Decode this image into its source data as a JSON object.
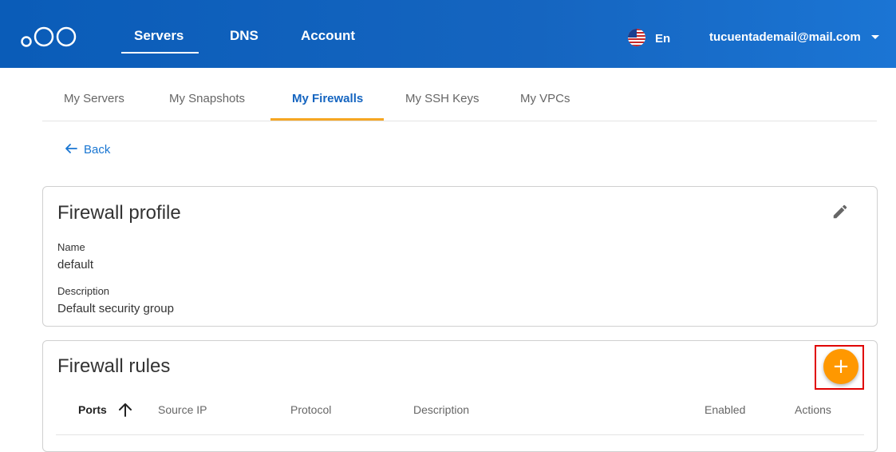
{
  "header": {
    "nav": [
      "Servers",
      "DNS",
      "Account"
    ],
    "language": "En",
    "user_email": "tucuentademail@mail.com"
  },
  "tabs": [
    "My Servers",
    "My Snapshots",
    "My Firewalls",
    "My SSH Keys",
    "My VPCs"
  ],
  "active_tab": "My Firewalls",
  "back_label": "Back",
  "profile": {
    "title": "Firewall profile",
    "name_label": "Name",
    "name_value": "default",
    "description_label": "Description",
    "description_value": "Default security group"
  },
  "rules": {
    "title": "Firewall rules",
    "add_label": "+",
    "columns": [
      "Ports",
      "Source IP",
      "Protocol",
      "Description",
      "Enabled",
      "Actions"
    ]
  },
  "colors": {
    "header": "#1565c0",
    "accent": "#f5a623",
    "fab": "#ff9800",
    "link": "#1976d2",
    "highlight": "#e00000"
  }
}
